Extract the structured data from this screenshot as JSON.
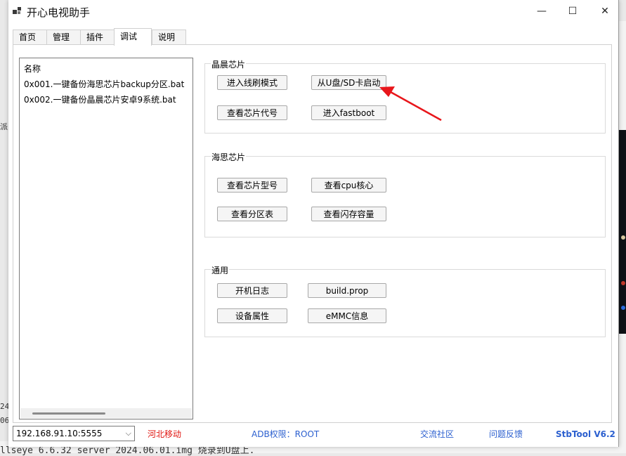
{
  "window": {
    "title": "开心电视助手",
    "controls": {
      "minimize": "—",
      "maximize": "☐",
      "close": "✕"
    }
  },
  "tabs": [
    {
      "label": "首页",
      "active": false
    },
    {
      "label": "管理",
      "active": false
    },
    {
      "label": "插件",
      "active": false
    },
    {
      "label": "调试",
      "active": true
    },
    {
      "label": "说明",
      "active": false
    }
  ],
  "script_list": {
    "header": "名称",
    "items": [
      "0x001.一键备份海思芯片backup分区.bat",
      "0x002.一键备份晶晨芯片安卓9系统.bat"
    ]
  },
  "groups": {
    "amlogic": {
      "label": "晶晨芯片",
      "buttons": [
        "进入线刷模式",
        "从U盘/SD卡启动",
        "查看芯片代号",
        "进入fastboot"
      ]
    },
    "hisilicon": {
      "label": "海思芯片",
      "buttons": [
        "查看芯片型号",
        "查看cpu核心",
        "查看分区表",
        "查看闪存容量"
      ]
    },
    "general": {
      "label": "通用",
      "buttons": [
        "开机日志",
        "build.prop",
        "设备属性",
        "eMMC信息"
      ]
    }
  },
  "status_bar": {
    "device": "192.168.91.10:5555",
    "carrier": "河北移动",
    "adb": "ADB权限：ROOT",
    "community": "交流社区",
    "feedback": "问题反馈",
    "version": "StbTool V6.2"
  },
  "background": {
    "terminal_line": "llseye 6.6.32 server 2024.06.01.img 烧录到U盘上.",
    "left_fragments": [
      "派",
      "24",
      "06"
    ]
  },
  "colors": {
    "carrier": "#e0140f",
    "link": "#2b5fcf",
    "annotation_arrow": "#e8161b"
  }
}
